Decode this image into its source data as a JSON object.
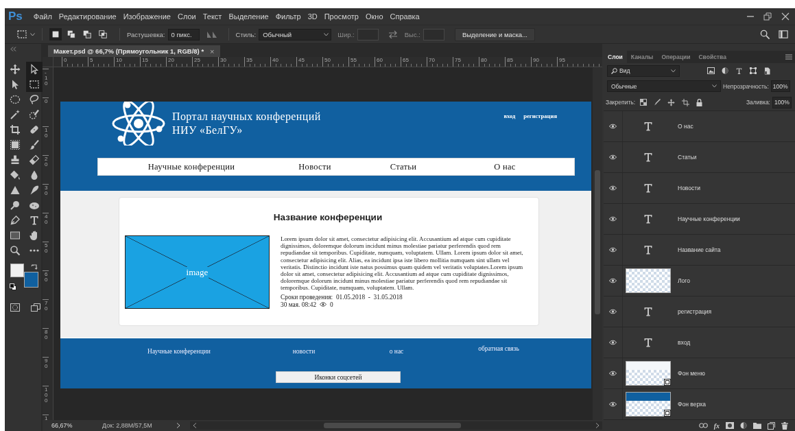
{
  "app": {
    "logo": "Ps"
  },
  "menu": [
    "Файл",
    "Редактирование",
    "Изображение",
    "Слои",
    "Текст",
    "Выделение",
    "Фильтр",
    "3D",
    "Просмотр",
    "Окно",
    "Справка"
  ],
  "options_bar": {
    "modes": [
      {
        "selected": true
      },
      {
        "selected": false
      },
      {
        "selected": false
      },
      {
        "selected": false
      }
    ],
    "feather_label": "Растушевка:",
    "feather_value": "0 пикс.",
    "style_label": "Стиль:",
    "style_value": "Обычный",
    "size_fields": [
      {
        "label": "Шир.:",
        "disabled": true
      },
      {
        "label": "Выс.:",
        "disabled": true
      }
    ],
    "mask_button": "Выделение и маска..."
  },
  "tools": {
    "items": [
      {
        "selected": false
      },
      {
        "selected": true
      },
      {
        "selected": false
      },
      {
        "selected": true
      },
      {
        "selected": false
      },
      {
        "selected": false
      },
      {
        "selected": false
      },
      {
        "selected": false
      },
      {
        "selected": false
      },
      {
        "selected": false
      },
      {
        "selected": false
      },
      {
        "selected": false
      },
      {
        "selected": false
      },
      {
        "selected": false
      },
      {
        "selected": false
      },
      {
        "selected": false
      },
      {
        "selected": false
      },
      {
        "selected": false
      },
      {
        "selected": false
      },
      {
        "selected": false
      },
      {
        "selected": false
      },
      {
        "selected": false
      },
      {
        "selected": false
      },
      {
        "selected": false
      },
      {
        "selected": false
      },
      {
        "selected": false
      }
    ],
    "swatches": [
      {
        "color": "#f0f0f0"
      },
      {
        "color": "#1060a0"
      }
    ]
  },
  "document": {
    "tab": {
      "title": "Макет.psd @ 66,7% (Прямоугольник 1, RGB/8) *",
      "close": "×"
    },
    "ruler_h": [
      "0",
      "5",
      "10",
      "15",
      "20",
      "25",
      "30",
      "35",
      "40",
      "45",
      "50",
      "55",
      "60",
      "65",
      "70",
      "75",
      "80",
      "85",
      "90",
      "95"
    ],
    "ruler_v": [
      "-10",
      "0",
      "10",
      "20",
      "30",
      "40",
      "50",
      "60",
      "70",
      "80",
      "90",
      "100",
      "1"
    ],
    "page": {
      "site_title": [
        "Портал научных конференций",
        "НИУ «БелГУ»"
      ],
      "auth_links": [
        "вход",
        "регистрация"
      ],
      "nav": [
        "Научные конференции",
        "Новости",
        "Статьи",
        "О нас"
      ],
      "card": {
        "title": "Название конференции",
        "image_label": "image",
        "text": "Lorem ipsum dolor sit amet, consectetur adipisicing elit. Accusantium ad atque cum cupiditate dignissimos, doloremque dolorum incidunt minus molestiae pariatur perferendis quod rem repudiandae sit temporibus. Cupiditate, numquam, voluptatem. Ullam. Lorem ipsum dolor sit amet, consectetur adipisicing elit. Alias, ea incidunt ipsa iste libero mollitia numquam sint ullam vel veritatis. Distinctio incidunt iste natus possimus quam quidem vel veritatis voluptates.Lorem ipsum dolor sit amet, consectetur adipisicing elit. Accusantium ad atque cum cupiditate dignissimos, doloremque dolorum incidunt minus molestiae pariatur perferendis quod rem repudiandae sit temporibus. Cupiditate, numquam, voluptatem. Ullam.",
        "dates": "Сроки проведения:  01.05.2018  -  31.05.2018",
        "posted": "30 мая. 08:42",
        "views": "0"
      },
      "footer_links": [
        "Научные конференции",
        "новости",
        "о нас",
        "обратная связь"
      ],
      "social_button": "Иконки соцсетей"
    }
  },
  "status_bar": {
    "zoom": "66,67%",
    "doc_info": "Док: 2,88M/57,5M"
  },
  "layers_panel": {
    "tabs": [
      {
        "label": "Слои",
        "selected": true
      },
      {
        "label": "Каналы",
        "selected": false
      },
      {
        "label": "Операции",
        "selected": false
      },
      {
        "label": "Свойства",
        "selected": false
      }
    ],
    "filter": "Вид",
    "blend_mode": "Обычные",
    "opacity_label": "Непрозрачность:",
    "opacity": "100%",
    "lock_label": "Закрепить:",
    "fill_label": "Заливка:",
    "fill": "100%",
    "layers": [
      {
        "name": "О нас",
        "kind": "text",
        "visible": true
      },
      {
        "name": "Статьи",
        "kind": "text",
        "visible": true
      },
      {
        "name": "Новости",
        "kind": "text",
        "visible": true
      },
      {
        "name": "Научные конференции",
        "kind": "text",
        "visible": true
      },
      {
        "name": "Название сайта",
        "kind": "text",
        "visible": true
      },
      {
        "name": "Лого",
        "kind": "raster",
        "visible": true
      },
      {
        "name": "регистрация",
        "kind": "text",
        "visible": true
      },
      {
        "name": "вход",
        "kind": "text",
        "visible": true
      },
      {
        "name": "Фон меню",
        "kind": "shape",
        "color": "#f4f7fa",
        "visible": true
      },
      {
        "name": "Фон верха",
        "kind": "shape",
        "color": "#1060a0",
        "visible": true
      }
    ],
    "effects_button": "fx"
  }
}
